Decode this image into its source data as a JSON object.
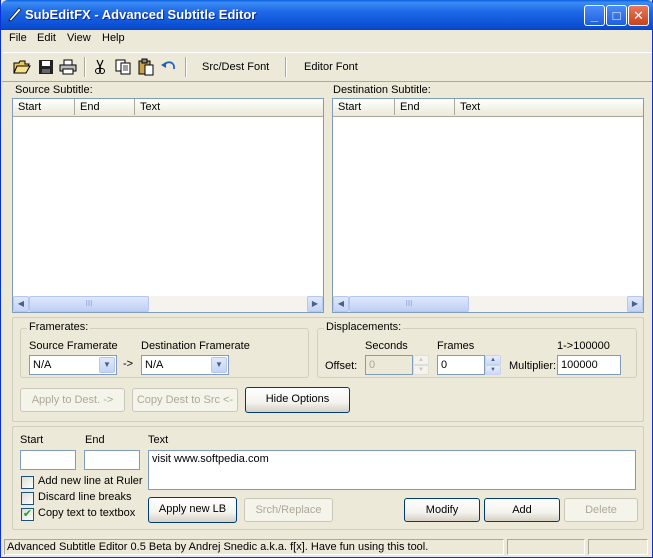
{
  "window": {
    "title": "SubEditFX - Advanced Subtitle Editor",
    "minimize_label": "_",
    "maximize_label": "□",
    "close_label": "✕"
  },
  "menu": [
    "File",
    "Edit",
    "View",
    "Help"
  ],
  "toolbar": {
    "icons": [
      "open-folder-icon",
      "save-icon",
      "print-icon",
      "cut-icon",
      "copy-icon",
      "paste-icon",
      "undo-icon"
    ],
    "src_dest_font_label": "Src/Dest Font",
    "editor_font_label": "Editor Font"
  },
  "source_subtitle": {
    "label": "Source Subtitle:",
    "columns": [
      "Start",
      "End",
      "Text"
    ],
    "thumb_glyph": "III"
  },
  "destination_subtitle": {
    "label": "Destination Subtitle:",
    "columns": [
      "Start",
      "End",
      "Text"
    ],
    "thumb_glyph": "III"
  },
  "framerates": {
    "group_label": "Framerates:",
    "source_label": "Source Framerate",
    "source_value": "N/A",
    "arrow_label": "->",
    "destination_label": "Destination Framerate",
    "destination_value": "N/A"
  },
  "displacements": {
    "group_label": "Displacements:",
    "seconds_label": "Seconds",
    "frames_label": "Frames",
    "range_label": "1->100000",
    "offset_label": "Offset:",
    "seconds_value": "0",
    "frames_value": "0",
    "multiplier_label": "Multiplier:",
    "multiplier_value": "100000"
  },
  "actions": {
    "apply_to_dest": "Apply to Dest. ->",
    "copy_dest_to_src": "Copy Dest to Src <-",
    "hide_options": "Hide Options"
  },
  "editor": {
    "start_label": "Start",
    "end_label": "End",
    "text_label": "Text",
    "start_value": "",
    "end_value": "",
    "text_value": "visit www.softpedia.com",
    "add_new_line_label": "Add new line at Ruler",
    "add_new_line_checked": false,
    "discard_line_breaks_label": "Discard line breaks",
    "discard_line_breaks_checked": false,
    "copy_text_label": "Copy text to textbox",
    "copy_text_checked": true,
    "check_mark": "✔",
    "apply_new_lb": "Apply new LB",
    "srch_replace": "Srch/Replace",
    "modify": "Modify",
    "add": "Add",
    "delete": "Delete"
  },
  "status": {
    "text": "Advanced Subtitle Editor 0.5 Beta by Andrej Snedic a.k.a. f[x]. Have fun using this tool."
  }
}
